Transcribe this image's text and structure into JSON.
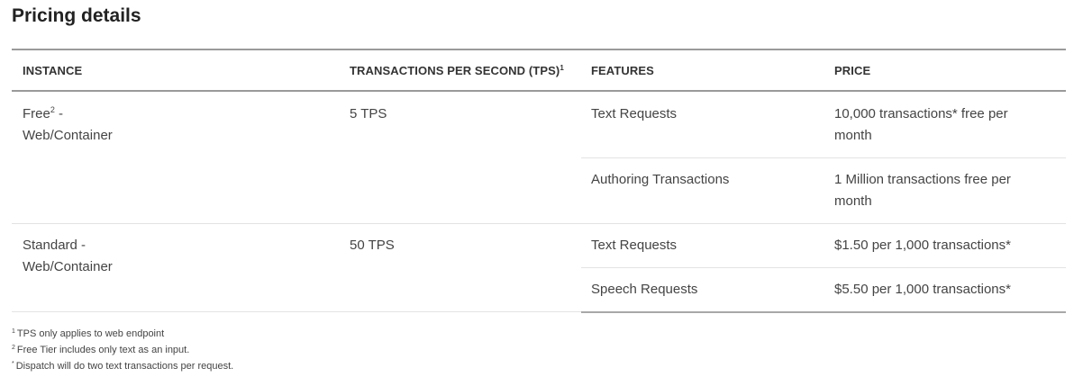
{
  "page": {
    "title": "Pricing details"
  },
  "table": {
    "headers": {
      "instance": "INSTANCE",
      "tps": "TRANSACTIONS PER SECOND (TPS)",
      "tps_sup": "1",
      "features": "FEATURES",
      "price": "PRICE"
    },
    "rows": [
      {
        "instance_line1": "Free",
        "instance_sup": "2",
        "instance_line1_suffix": " -",
        "instance_line2": "Web/Container",
        "tps": "5 TPS",
        "features": [
          {
            "feature": "Text Requests",
            "price_line1": "10,000 transactions* free per",
            "price_line2": "month"
          },
          {
            "feature": "Authoring Transactions",
            "price_line1": "1 Million transactions free per",
            "price_line2": "month"
          }
        ]
      },
      {
        "instance_line1": "Standard -",
        "instance_line2": "Web/Container",
        "tps": "50 TPS",
        "features": [
          {
            "feature": "Text Requests",
            "price_line1": "$1.50 per 1,000 transactions*"
          },
          {
            "feature": "Speech Requests",
            "price_line1": "$5.50 per 1,000 transactions*"
          }
        ]
      }
    ]
  },
  "footnotes": [
    {
      "mark": "1",
      "text": "TPS only applies to web endpoint"
    },
    {
      "mark": "2",
      "text": "Free Tier includes only text as an input."
    },
    {
      "mark": "*",
      "text": "Dispatch will do two text transactions per request."
    }
  ]
}
